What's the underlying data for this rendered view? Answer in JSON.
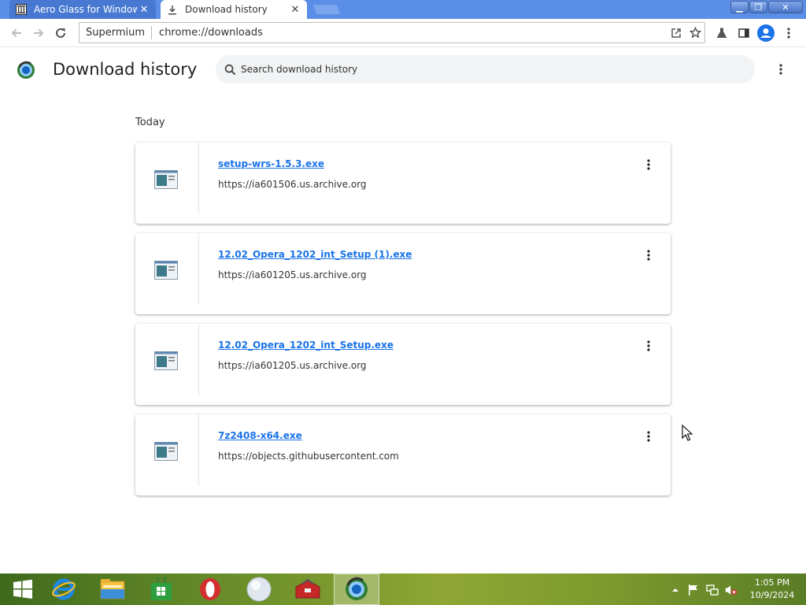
{
  "browser": {
    "tabs": [
      {
        "title": "Aero Glass for Windows",
        "icon": "archive-org-icon",
        "active": false
      },
      {
        "title": "Download history",
        "icon": "download-icon",
        "active": true
      }
    ],
    "close_glyph": "✕",
    "window_controls": {
      "minimize": "▁",
      "maximize": "❐",
      "close": "✕"
    },
    "omnibox": {
      "chip": "Supermium",
      "url": "chrome://downloads"
    }
  },
  "page": {
    "title": "Download history",
    "search": {
      "placeholder": "Search download history"
    },
    "section_label": "Today",
    "downloads": [
      {
        "name": "setup-wrs-1.5.3.exe",
        "url": "https://ia601506.us.archive.org"
      },
      {
        "name": "12.02_Opera_1202_int_Setup (1).exe",
        "url": "https://ia601205.us.archive.org"
      },
      {
        "name": "12.02_Opera_1202_int_Setup.exe",
        "url": "https://ia601205.us.archive.org"
      },
      {
        "name": "7z2408-x64.exe",
        "url": "https://objects.githubusercontent.com"
      }
    ]
  },
  "taskbar": {
    "items": [
      "start-icon",
      "internet-explorer-icon",
      "file-explorer-icon",
      "store-icon",
      "opera-icon",
      "browser-ball-icon",
      "toolbox-icon",
      "supermium-icon"
    ],
    "active_item": "supermium-icon",
    "clock": {
      "time": "1:05 PM",
      "date": "10/9/2024"
    }
  },
  "colors": {
    "titlebar": "#5b8ee6",
    "link": "#1a73e8",
    "search_bg": "#f1f3f4"
  }
}
